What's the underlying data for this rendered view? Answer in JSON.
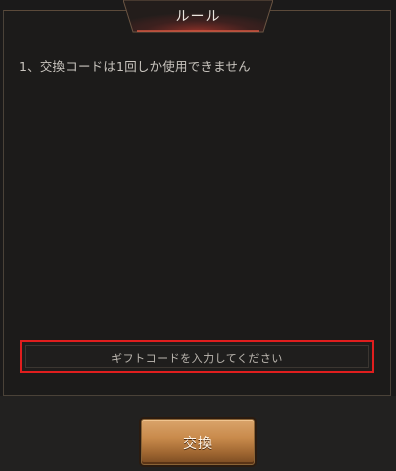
{
  "dialog": {
    "title": "ルール",
    "rule_text": "1、交換コードは1回しか使用できません"
  },
  "code_input": {
    "placeholder": "ギフトコードを入力してください",
    "value": ""
  },
  "exchange_button": {
    "label": "交換"
  },
  "colors": {
    "background": "#1c1b1a",
    "input_highlight": "#e01e1e",
    "button_gold": "#c98b4c",
    "title_glow": "#c0392b"
  }
}
